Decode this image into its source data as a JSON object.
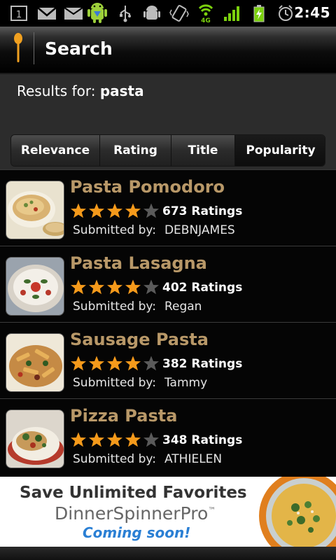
{
  "status_bar": {
    "time": "2:45",
    "icons": [
      "sim-1-icon",
      "gmail-icon",
      "email-icon",
      "android-icon",
      "usb-icon",
      "debug-icon",
      "vibrate-icon",
      "wifi-4g-icon",
      "signal-icon",
      "battery-charging-icon",
      "alarm-icon"
    ],
    "notification_count": "1",
    "network_label": "4G"
  },
  "header": {
    "title": "Search",
    "icon": "spoon-icon"
  },
  "results": {
    "label": "Results for:",
    "query": "pasta"
  },
  "sort_tabs": [
    {
      "label": "Relevance"
    },
    {
      "label": "Rating"
    },
    {
      "label": "Title"
    },
    {
      "label": "Popularity",
      "active": true
    }
  ],
  "recipes": [
    {
      "title": "Pasta Pomodoro",
      "rating": 4,
      "max_rating": 5,
      "ratings_text": "673 Ratings",
      "submitted_label": "Submitted by:",
      "submitter": "DEBNJAMES"
    },
    {
      "title": "Pasta Lasagna",
      "rating": 4,
      "max_rating": 5,
      "ratings_text": "402 Ratings",
      "submitted_label": "Submitted by:",
      "submitter": "Regan"
    },
    {
      "title": "Sausage Pasta",
      "rating": 4,
      "max_rating": 5,
      "ratings_text": "382 Ratings",
      "submitted_label": "Submitted by:",
      "submitter": "Tammy"
    },
    {
      "title": "Pizza Pasta",
      "rating": 4,
      "max_rating": 5,
      "ratings_text": "348 Ratings",
      "submitted_label": "Submitted by:",
      "submitter": "ATHIELEN"
    }
  ],
  "ad": {
    "headline": "Save Unlimited Favorites",
    "brand": "DinnerSpinnerPro",
    "trademark": "™",
    "tagline": "Coming soon!"
  },
  "colors": {
    "title_gold": "#b89868",
    "star_on": "#f59a1b",
    "star_off": "#5a5a5a",
    "tagline_blue": "#2a7fd4"
  }
}
